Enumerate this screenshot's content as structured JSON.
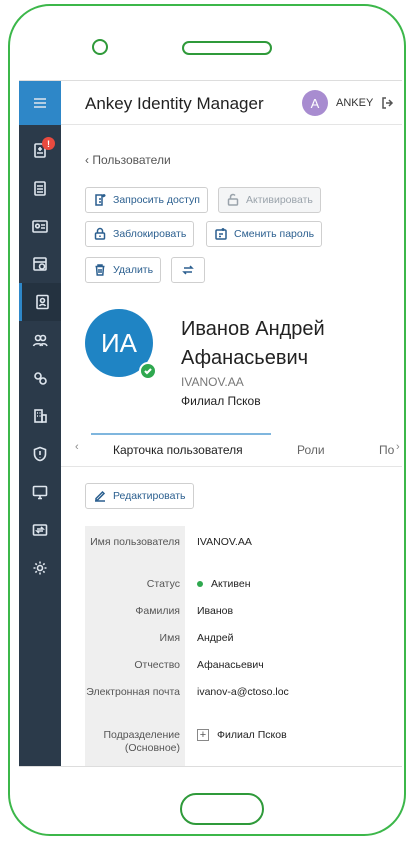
{
  "header": {
    "title": "Ankey Identity Manager",
    "avatar_letter": "A",
    "username": "ANKEY"
  },
  "sidebar": {
    "alert_badge": "!"
  },
  "nav": {
    "back_label": "‹ Пользователи"
  },
  "actions": {
    "request_access": "Запросить доступ",
    "activate": "Активировать",
    "block": "Заблокировать",
    "change_password": "Сменить пароль",
    "delete": "Удалить"
  },
  "profile": {
    "initials": "ИА",
    "full_name": "Иванов Андрей Афанасьевич",
    "login": "IVANOV.AA",
    "branch": "Филиал Псков"
  },
  "tabs": [
    {
      "label": "Карточка пользователя"
    },
    {
      "label": "Роли"
    },
    {
      "label": "По"
    }
  ],
  "edit_label": "Редактировать",
  "details": {
    "username_label": "Имя пользователя",
    "username_value": "IVANOV.AA",
    "status_label": "Статус",
    "status_value": "Активен",
    "lastname_label": "Фамилия",
    "lastname_value": "Иванов",
    "firstname_label": "Имя",
    "firstname_value": "Андрей",
    "middlename_label": "Отчество",
    "middlename_value": "Афанасьевич",
    "email_label": "Электронная почта",
    "email_value": "ivanov-a@ctoso.loc",
    "department_label": "Подразделение (Основное)",
    "department_value": "Филиал Псков"
  },
  "colors": {
    "accent": "#2e87c8",
    "sidebar": "#2b3a4a",
    "frame": "#3cb74a",
    "active_status": "#2fa84f"
  }
}
